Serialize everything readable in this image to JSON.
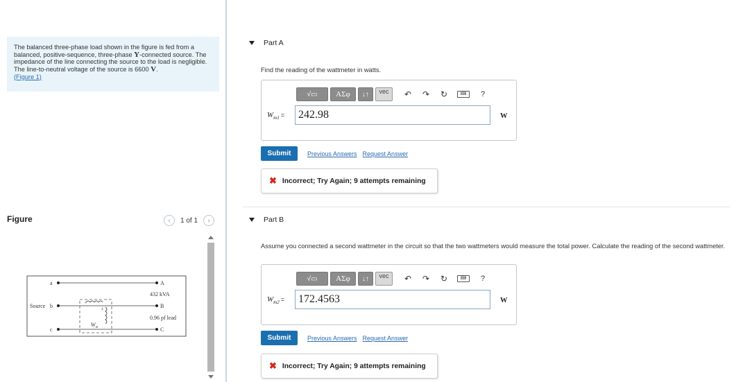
{
  "problem": {
    "text_part1": "The balanced three-phase load shown in the figure is fed from a balanced, positive-sequence, three-phase ",
    "y_symbol": "Y",
    "text_part2": "-connected source. The impedance of the line connecting the source to the load is negligible. The line-to-neutral voltage of the source is 6600 ",
    "v_symbol": "V",
    "text_part3": ".",
    "figure_link": "(Figure 1)"
  },
  "figure": {
    "label": "Figure",
    "pager": "1 of 1",
    "prev_icon": "chevron-left-icon",
    "next_icon": "chevron-right-icon",
    "circuit": {
      "node_a": "a",
      "node_b": "b",
      "node_c": "c",
      "source_label": "Source",
      "node_A": "A",
      "node_B": "B",
      "node_C": "C",
      "load_power": "432 kVA",
      "load_pf": "0.96 pf lead",
      "wattmeter_label": "W",
      "wattmeter_sub": "m"
    }
  },
  "toolbar": {
    "sqrt_label": "√▭",
    "greek_label": "AΣφ",
    "arrows_label": "↓↑",
    "vec_label": "vec",
    "undo_icon": "undo-icon",
    "redo_icon": "redo-icon",
    "reset_icon": "reset-icon",
    "keyboard_icon": "keyboard-icon",
    "help_label": "?"
  },
  "partA": {
    "title": "Part A",
    "question": "Find the reading of the wattmeter in watts.",
    "var_main": "W",
    "var_sub": "m1",
    "equals": "=",
    "answer": "242.98",
    "unit": "W",
    "submit_label": "Submit",
    "prev_answers_label": "Previous Answers",
    "request_answer_label": "Request Answer",
    "feedback": "Incorrect; Try Again; 9 attempts remaining"
  },
  "partB": {
    "title": "Part B",
    "question": "Assume you connected a second wattmeter in the circuit so that the two wattmeters would measure the total power. Calculate the reading of the second wattmeter.",
    "var_main": "W",
    "var_sub": "m2",
    "equals": "=",
    "answer": "172.4563",
    "unit": "W",
    "submit_label": "Submit",
    "prev_answers_label": "Previous Answers",
    "request_answer_label": "Request Answer",
    "feedback": "Incorrect; Try Again; 9 attempts remaining"
  },
  "colors": {
    "problem_bg": "#e8f4f9",
    "submit_bg": "#1a6fb0",
    "link": "#2a6ab0",
    "error": "#d5281b"
  }
}
